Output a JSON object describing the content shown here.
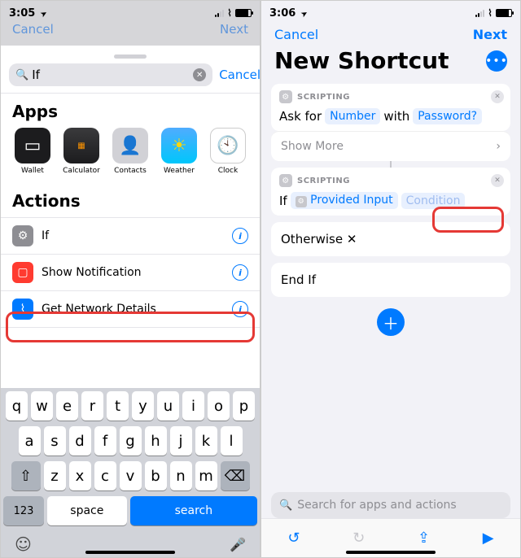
{
  "left": {
    "time": "3:05",
    "location_glyph": "➤",
    "behind_nav": {
      "cancel": "Cancel",
      "next": "Next"
    },
    "search": {
      "value": "If",
      "cancel": "Cancel"
    },
    "apps_header": "Apps",
    "apps": [
      {
        "label": "Wallet"
      },
      {
        "label": "Calculator"
      },
      {
        "label": "Contacts"
      },
      {
        "label": "Weather"
      },
      {
        "label": "Clock"
      }
    ],
    "actions_header": "Actions",
    "actions": [
      {
        "label": "If"
      },
      {
        "label": "Show Notification"
      },
      {
        "label": "Get Network Details"
      }
    ],
    "keyboard": {
      "row1": [
        "q",
        "w",
        "e",
        "r",
        "t",
        "y",
        "u",
        "i",
        "o",
        "p"
      ],
      "row2": [
        "a",
        "s",
        "d",
        "f",
        "g",
        "h",
        "j",
        "k",
        "l"
      ],
      "row3": [
        "z",
        "x",
        "c",
        "v",
        "b",
        "n",
        "m"
      ],
      "shift": "⇧",
      "backspace": "⌫",
      "numbers": "123",
      "space": "space",
      "search": "search",
      "emoji": "☺",
      "mic": "🎤"
    }
  },
  "right": {
    "time": "3:06",
    "location_glyph": "➤",
    "nav": {
      "cancel": "Cancel",
      "next": "Next"
    },
    "title": "New Shortcut",
    "scripting_label": "SCRIPTING",
    "askfor": {
      "prefix": "Ask for",
      "token1": "Number",
      "mid": "with",
      "token2": "Password?"
    },
    "show_more": "Show More",
    "if_block": {
      "prefix": "If",
      "token_input": "Provided Input",
      "token_cond": "Condition"
    },
    "otherwise": "Otherwise",
    "endif": "End If",
    "search_placeholder": "Search for apps and actions",
    "toolbar": {
      "undo": "↺",
      "redo": "↻",
      "share": "⇪",
      "play": "▶"
    }
  }
}
